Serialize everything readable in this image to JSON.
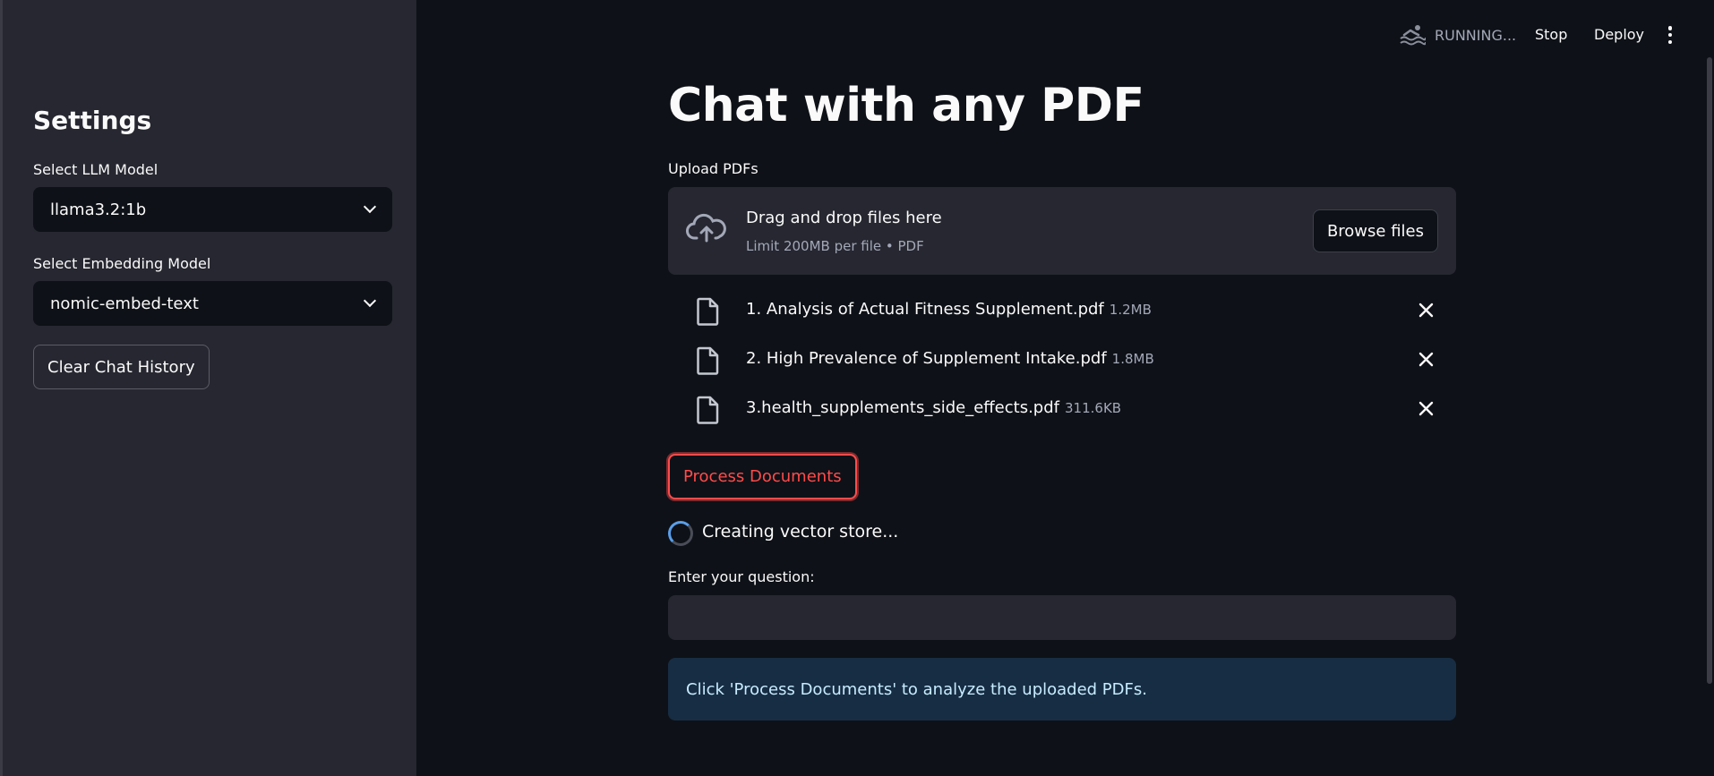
{
  "header": {
    "status": "RUNNING...",
    "stop_label": "Stop",
    "deploy_label": "Deploy"
  },
  "sidebar": {
    "title": "Settings",
    "llm_label": "Select LLM Model",
    "llm_value": "llama3.2:1b",
    "embed_label": "Select Embedding Model",
    "embed_value": "nomic-embed-text",
    "clear_label": "Clear Chat History"
  },
  "main": {
    "title": "Chat with any PDF",
    "upload_label": "Upload PDFs",
    "dropzone_text": "Drag and drop files here",
    "dropzone_sub": "Limit 200MB per file • PDF",
    "browse_label": "Browse files",
    "files": [
      {
        "name": "1. Analysis of Actual Fitness Supplement.pdf",
        "size": "1.2MB"
      },
      {
        "name": "2. High Prevalence of Supplement Intake.pdf",
        "size": "1.8MB"
      },
      {
        "name": "3.health_supplements_side_effects.pdf",
        "size": "311.6KB"
      }
    ],
    "process_label": "Process Documents",
    "spinner_text": "Creating vector store...",
    "question_label": "Enter your question:",
    "question_value": "",
    "info_text": "Click 'Process Documents' to analyze the uploaded PDFs."
  },
  "colors": {
    "background": "#0e1117",
    "sidebar": "#262730",
    "accent": "#ff4b4b",
    "info_bg": "#172d43",
    "info_text": "#c7ebff"
  },
  "icons": {
    "status": "swimmer-icon",
    "upload": "cloud-upload-icon",
    "file": "file-icon",
    "remove": "close-icon",
    "menu": "kebab-menu-icon",
    "dropdown": "chevron-down-icon"
  }
}
